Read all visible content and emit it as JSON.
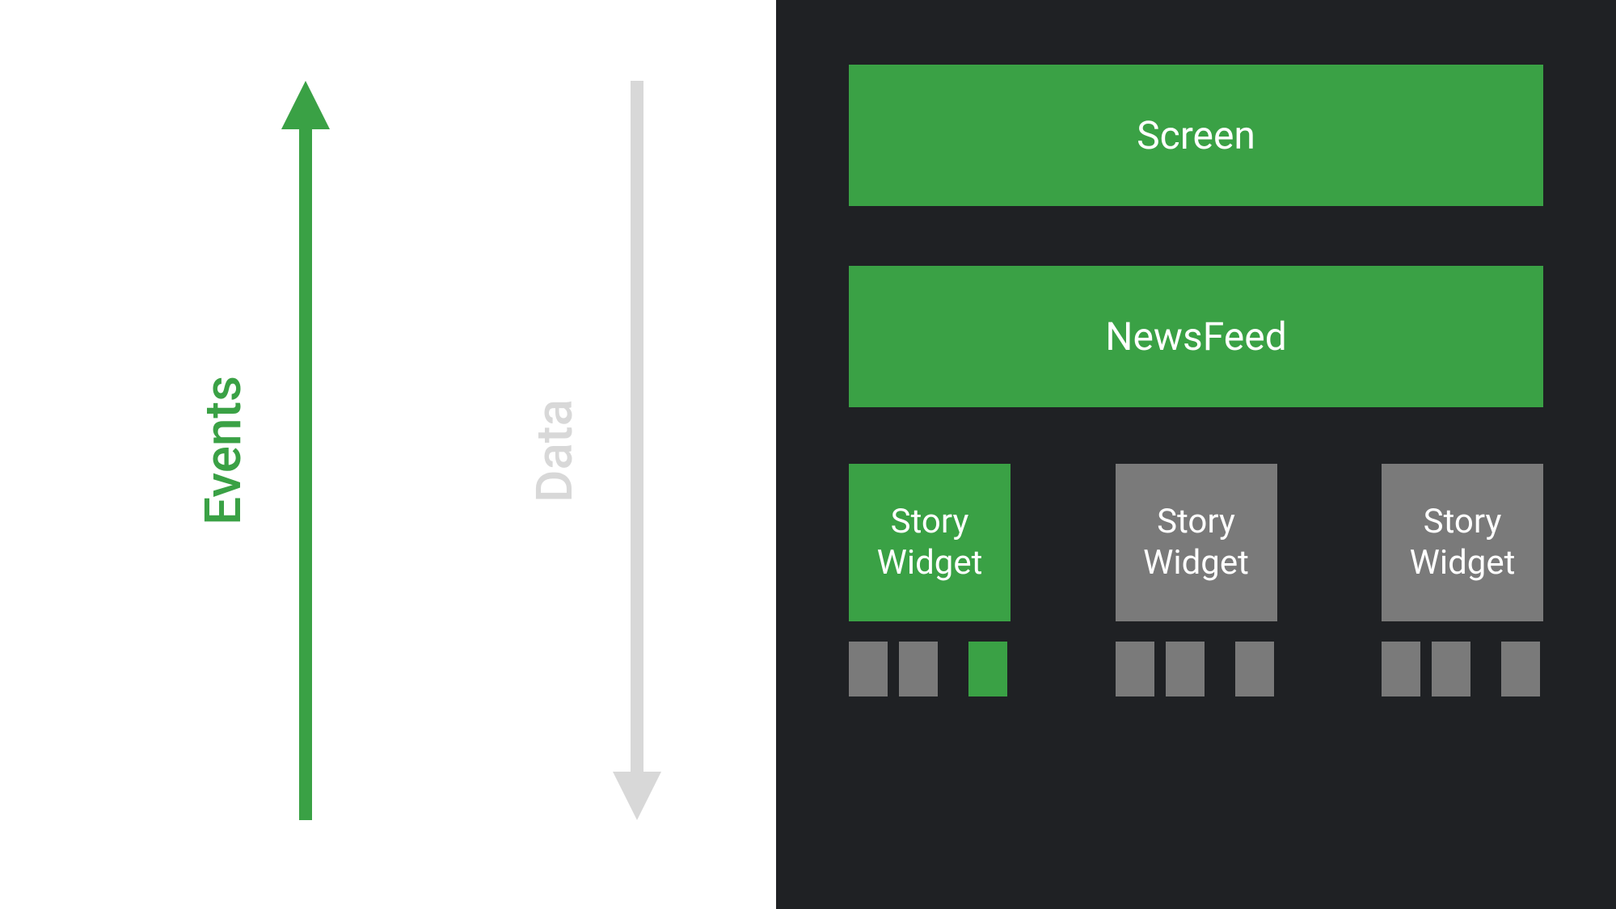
{
  "arrows": {
    "events": {
      "label": "Events",
      "direction": "up",
      "color": "#3aa145"
    },
    "data": {
      "label": "Data",
      "direction": "down",
      "color": "#d8d8d8"
    }
  },
  "hierarchy": {
    "screen": {
      "label": "Screen",
      "active": true
    },
    "newsfeed": {
      "label": "NewsFeed",
      "active": true
    },
    "widgets": [
      {
        "line1": "Story",
        "line2": "Widget",
        "active": true,
        "ticks": [
          false,
          false,
          true
        ]
      },
      {
        "line1": "Story",
        "line2": "Widget",
        "active": false,
        "ticks": [
          false,
          false,
          false
        ]
      },
      {
        "line1": "Story",
        "line2": "Widget",
        "active": false,
        "ticks": [
          false,
          false,
          false
        ]
      }
    ]
  },
  "colors": {
    "green": "#3aa145",
    "gray": "#7a7a7a",
    "lightGray": "#d8d8d8",
    "dark": "#1f2124",
    "white": "#ffffff"
  }
}
